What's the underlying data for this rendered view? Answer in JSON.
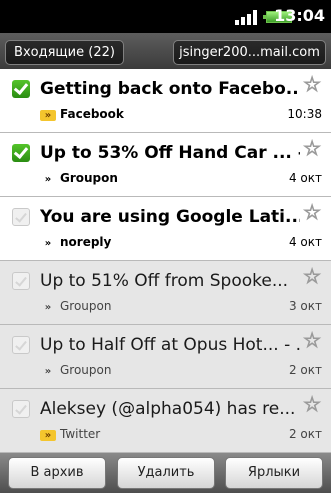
{
  "status_bar": {
    "time": "13:04",
    "signal_icon": "signal-bars-icon",
    "battery_icon": "battery-icon"
  },
  "header": {
    "inbox_label": "Входящие (22)",
    "account_label": "jsinger200...mail.com"
  },
  "messages": [
    {
      "subject": "Getting back onto Facebo...",
      "sender": "Facebook",
      "sender_badge": "»",
      "badge_style": "boxed",
      "date": "10:38",
      "checked": true,
      "read": false
    },
    {
      "subject": "Up to 53% Off Hand Car ... - ...",
      "sender": "Groupon",
      "sender_badge": "»",
      "badge_style": "plain",
      "date": "4 окт",
      "checked": true,
      "read": false
    },
    {
      "subject": "You are using Google Lati...",
      "sender": "noreply",
      "sender_badge": "»",
      "badge_style": "plain",
      "date": "4 окт",
      "checked": false,
      "read": false
    },
    {
      "subject": "Up to 51% Off from Spooke...",
      "sender": "Groupon",
      "sender_badge": "»",
      "badge_style": "plain",
      "date": "3 окт",
      "checked": false,
      "read": true
    },
    {
      "subject": "Up to Half Off at Opus Hot... - ...",
      "sender": "Groupon",
      "sender_badge": "»",
      "badge_style": "plain",
      "date": "2 окт",
      "checked": false,
      "read": true
    },
    {
      "subject": "Aleksey (@alpha054) has re...",
      "sender": "Twitter",
      "sender_badge": "»",
      "badge_style": "boxed",
      "date": "2 окт",
      "checked": false,
      "read": true
    }
  ],
  "toolbar": {
    "archive_label": "В архив",
    "delete_label": "Удалить",
    "labels_label": "Ярлыки"
  },
  "colors": {
    "checked": "#3aa51c",
    "badge": "#f4c52d",
    "read_row_bg": "#e6e6e6"
  }
}
